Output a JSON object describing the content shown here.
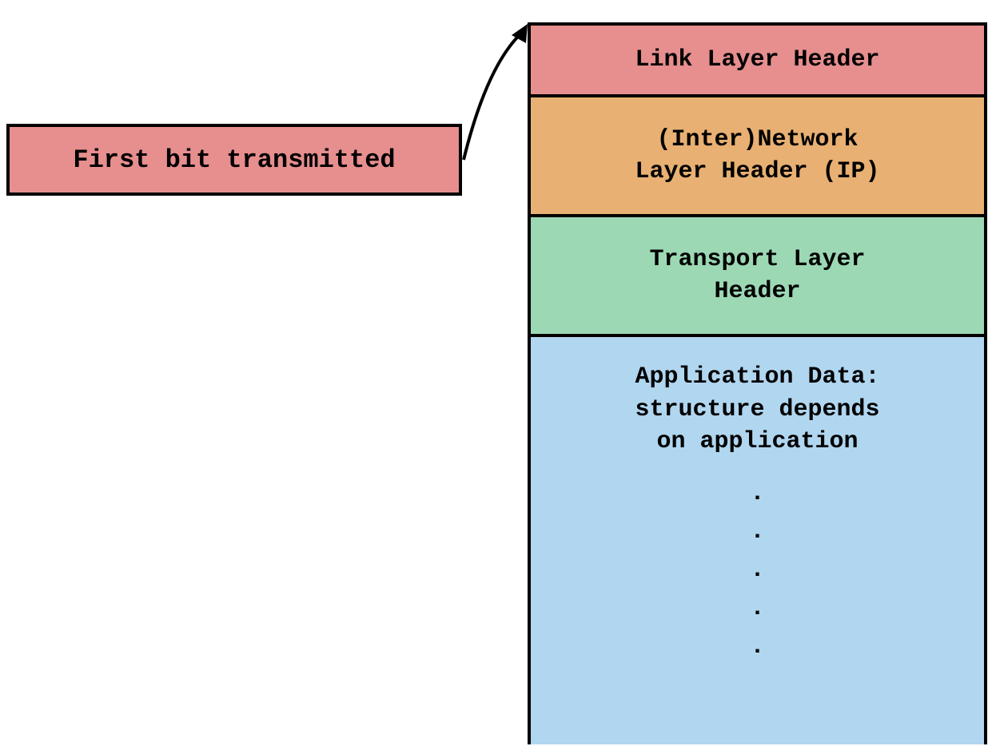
{
  "first_bit_label": "First bit transmitted",
  "layers": {
    "link": "Link Layer Header",
    "network_line1": "(Inter)Network",
    "network_line2": "Layer Header (IP)",
    "transport_line1": "Transport Layer",
    "transport_line2": "Header",
    "app_line1": "Application Data:",
    "app_line2": "structure depends",
    "app_line3": "on application"
  },
  "colors": {
    "link": "#e78e8e",
    "network": "#e8b072",
    "transport": "#9cd8b4",
    "application": "#b1d6f0"
  }
}
